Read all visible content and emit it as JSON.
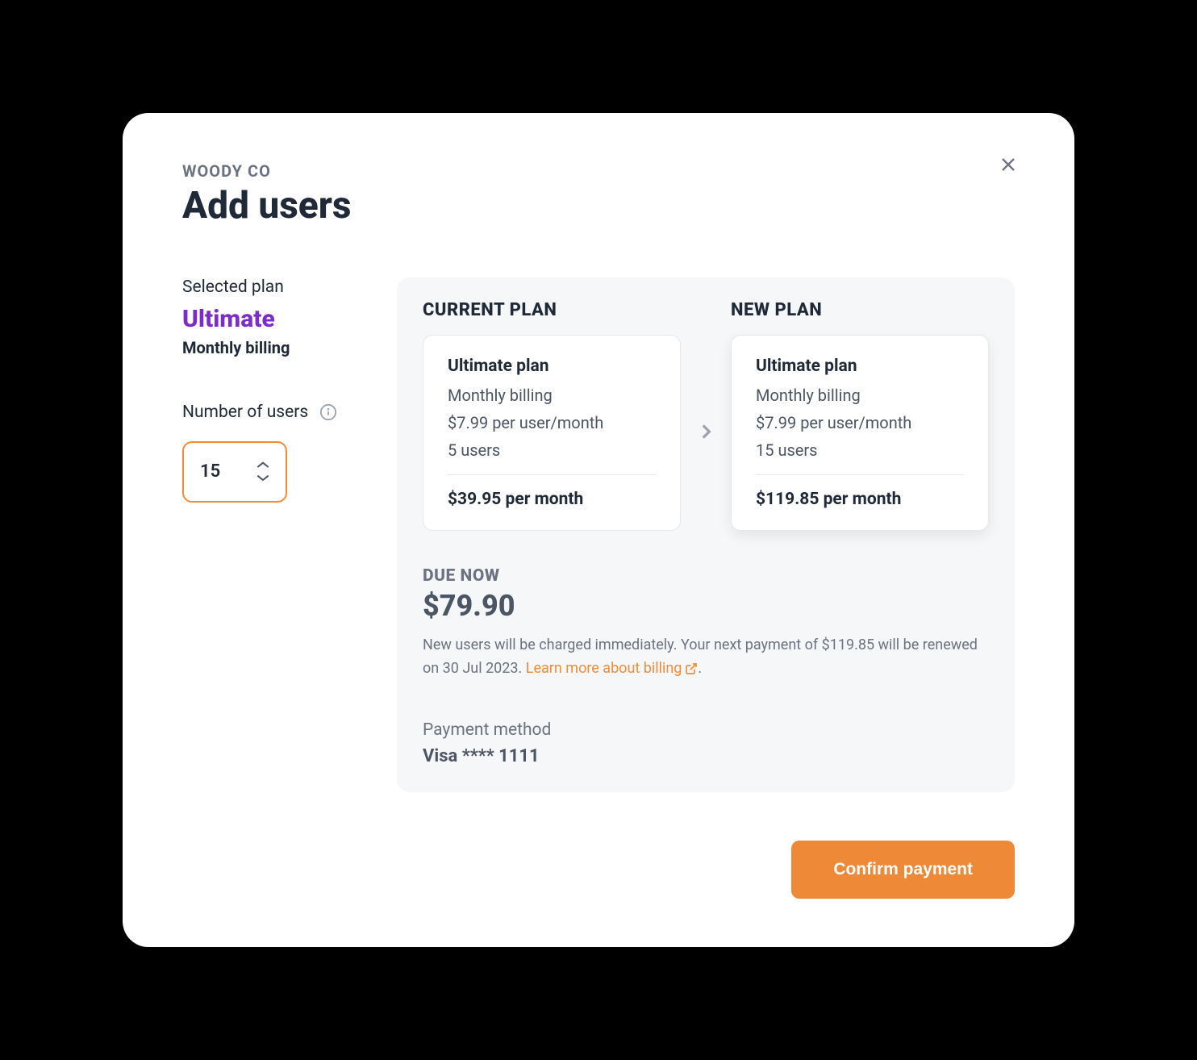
{
  "header": {
    "org_name": "WOODY CO",
    "title": "Add users"
  },
  "left": {
    "selected_plan_label": "Selected plan",
    "plan_name": "Ultimate",
    "billing_cycle": "Monthly billing",
    "users_label": "Number of users",
    "users_value": "15"
  },
  "plans": {
    "current": {
      "heading": "CURRENT PLAN",
      "name": "Ultimate plan",
      "billing": "Monthly billing",
      "price": "$7.99 per user/month",
      "users": "5 users",
      "total": "$39.95 per month"
    },
    "new": {
      "heading": "NEW PLAN",
      "name": "Ultimate plan",
      "billing": "Monthly billing",
      "price": "$7.99 per user/month",
      "users": "15 users",
      "total": "$119.85 per month"
    }
  },
  "due": {
    "label": "DUE NOW",
    "amount": "$79.90",
    "note_prefix": "New users will be charged immediately. Your next payment of $119.85 will be renewed on 30 Jul 2023. ",
    "learn_link": "Learn more about billing",
    "note_suffix": "."
  },
  "payment_method": {
    "label": "Payment method",
    "value": "Visa **** 1111"
  },
  "footer": {
    "confirm_label": "Confirm payment"
  }
}
